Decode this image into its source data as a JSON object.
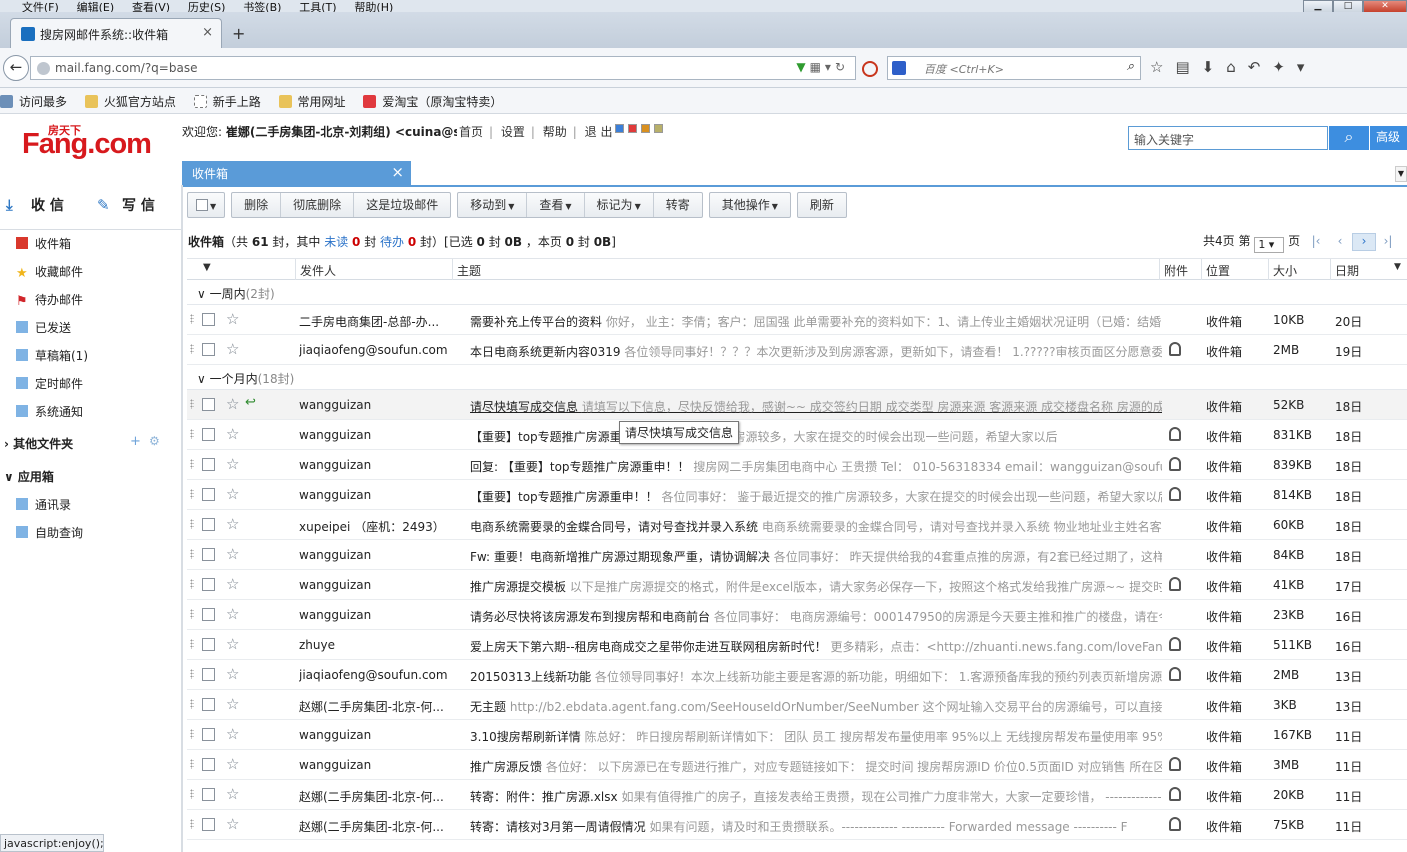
{
  "browser": {
    "menu": [
      "文件(F)",
      "编辑(E)",
      "查看(V)",
      "历史(S)",
      "书签(B)",
      "工具(T)",
      "帮助(H)"
    ],
    "tab_title": "搜房网邮件系统::收件箱",
    "url": "mail.fang.com/?q=base",
    "search_placeholder": "百度 <Ctrl+K>",
    "bookmarks": [
      "访问最多",
      "火狐官方站点",
      "新手上路",
      "常用网址",
      "爱淘宝（原淘宝特卖）"
    ],
    "status": "javascript:enjoy();"
  },
  "header": {
    "logo": "Fang.com",
    "logo_small": "房天下",
    "welcome_prefix": "欢迎您: ",
    "welcome_user": "崔娜(二手房集团-北京-刘莉组) <cuina@s",
    "links": [
      "首页",
      "设置",
      "帮助",
      "退 出"
    ],
    "search_placeholder": "输入关键字",
    "advanced": "高级",
    "skin_colors": [
      "#3b7fd8",
      "#e03a3a",
      "#d9901f",
      "#b8b06a"
    ]
  },
  "apptab": {
    "label": "收件箱"
  },
  "sidebar": {
    "receive": "收 信",
    "compose": "写 信",
    "folders": [
      {
        "label": "收件箱",
        "color": "#d9382c"
      },
      {
        "label": "收藏邮件",
        "color": "#f0b51c"
      },
      {
        "label": "待办邮件",
        "color": "#d1262b"
      },
      {
        "label": "已发送",
        "color": "#7fb3e4"
      },
      {
        "label": "草稿箱(1)",
        "color": "#7fb3e4"
      },
      {
        "label": "定时邮件",
        "color": "#7fb3e4"
      },
      {
        "label": "系统通知",
        "color": "#7fb3e4"
      }
    ],
    "other_folders": "其他文件夹",
    "apps": "应用箱",
    "app_items": [
      "通讯录",
      "自助查询"
    ]
  },
  "toolbar": {
    "groups": [
      [
        "删除",
        "彻底删除",
        "这是垃圾邮件"
      ],
      [
        "移动到",
        "查看",
        "标记为",
        "转寄"
      ],
      [
        "其他操作"
      ],
      [
        "刷新"
      ]
    ],
    "dropdowns": [
      "移动到",
      "查看",
      "标记为",
      "其他操作"
    ]
  },
  "summary": {
    "title": "收件箱",
    "total": "61",
    "unread_label": "未读",
    "unread": "0",
    "todo_label": "待办",
    "todo": "0",
    "selected": "0",
    "selected_size": "0B",
    "page_count": "0",
    "page_size": "0B"
  },
  "pager": {
    "total_pages": "共4页",
    "page_label": "第",
    "current": "1",
    "page_suffix": "页"
  },
  "columns": {
    "from": "发件人",
    "subject": "主题",
    "attach": "附件",
    "location": "位置",
    "size": "大小",
    "date": "日期"
  },
  "groups": [
    {
      "label": "一周内",
      "count": "(2封)"
    },
    {
      "label": "一个月内",
      "count": "(18封)"
    }
  ],
  "tooltip": "请尽快填写成交信息",
  "emails": [
    {
      "from": "二手房电商集团-总部-办...",
      "subject": "需要补充上传平台的资料",
      "preview": "你好， 业主：李倩；客户：屈国强 此单需要补充的资料如下：1、请上传业主婚姻状况证明（已婚：结婚",
      "att": false,
      "loc": "收件箱",
      "size": "10KB",
      "date": "20日"
    },
    {
      "from": "jiaqiaofeng@soufun.com",
      "subject": "本日电商系统更新内容0319",
      "preview": "各位领导同事好！？？？本次更新涉及到房源客源，更新如下，请查看！ 1.?????审核页面区分愿意委托",
      "att": true,
      "loc": "收件箱",
      "size": "2MB",
      "date": "19日"
    },
    {
      "from": "wangguizan",
      "subject": "请尽快填写成交信息",
      "preview": "请填写以下信息，尽快反馈给我，感谢~~ 成交签约日期 成交类型 房源来源 客源来源 成交楼盘名称 房源的成",
      "att": false,
      "loc": "收件箱",
      "size": "52KB",
      "date": "18日",
      "replied": true,
      "hover": true
    },
    {
      "from": "wangguizan",
      "subject": "【重要】top专题推广房源重",
      "preview": "鉴于最近提交的推广房源较多，大家在提交的时候会出现一些问题，希望大家以后",
      "att": true,
      "loc": "收件箱",
      "size": "831KB",
      "date": "18日"
    },
    {
      "from": "wangguizan",
      "subject": "回复: 【重要】top专题推广房源重申！！",
      "preview": "搜房网二手房集团电商中心 王贵攒 Tel： 010-56318334 email：wangguizan@soufun",
      "att": true,
      "loc": "收件箱",
      "size": "839KB",
      "date": "18日"
    },
    {
      "from": "wangguizan",
      "subject": "【重要】top专题推广房源重申！！",
      "preview": "各位同事好： 鉴于最近提交的推广房源较多，大家在提交的时候会出现一些问题，希望大家以后",
      "att": true,
      "loc": "收件箱",
      "size": "814KB",
      "date": "18日"
    },
    {
      "from": "xupeipei （座机：2493）",
      "subject": "电商系统需要录的金蝶合同号，请对号查找并录入系统",
      "preview": "电商系统需要录的金蝶合同号，请对号查找并录入系统 物业地址业主姓名客",
      "att": false,
      "loc": "收件箱",
      "size": "60KB",
      "date": "18日"
    },
    {
      "from": "wangguizan",
      "subject": "Fw: 重要！电商新增推广房源过期现象严重，请协调解决",
      "preview": "各位同事好： 昨天提供给我的4套重点推的房源，有2套已经过期了，这样",
      "att": false,
      "loc": "收件箱",
      "size": "84KB",
      "date": "18日"
    },
    {
      "from": "wangguizan",
      "subject": "推广房源提交模板",
      "preview": "以下是推广房源提交的格式，附件是excel版本，请大家务必保存一下，按照这个格式发给我推广房源~~ 提交时",
      "att": true,
      "loc": "收件箱",
      "size": "41KB",
      "date": "17日"
    },
    {
      "from": "wangguizan",
      "subject": "请务必尽快将该房源发布到搜房帮和电商前台",
      "preview": "各位同事好： 电商房源编号：000147950的房源是今天要主推和推广的楼盘，请在今",
      "att": false,
      "loc": "收件箱",
      "size": "23KB",
      "date": "16日"
    },
    {
      "from": "zhuye",
      "subject": "爱上房天下第六期--租房电商成交之星带你走进互联网租房新时代！",
      "preview": "更多精彩，点击：<http://zhuanti.news.fang.com/loveFang",
      "att": true,
      "loc": "收件箱",
      "size": "511KB",
      "date": "16日"
    },
    {
      "from": "jiaqiaofeng@soufun.com",
      "subject": "20150313上线新功能",
      "preview": "各位领导同事好！本次上线新功能主要是客源的新功能，明细如下： 1.客源预备库我的预约列表页新增房源",
      "att": true,
      "loc": "收件箱",
      "size": "2MB",
      "date": "13日"
    },
    {
      "from": "赵娜(二手房集团-北京-何...",
      "subject": "无主题",
      "preview": "http://b2.ebdata.agent.fang.com/SeeHouseIdOrNumber/SeeNumber 这个网址输入交易平台的房源编号，可以直接",
      "att": false,
      "loc": "收件箱",
      "size": "3KB",
      "date": "13日"
    },
    {
      "from": "wangguizan",
      "subject": "3.10搜房帮刷新详情",
      "preview": "陈总好： 昨日搜房帮刷新详情如下： 团队 员工 搜房帮发布量使用率 95%以上 无线搜房帮发布量使用率 95%",
      "att": false,
      "loc": "收件箱",
      "size": "167KB",
      "date": "11日"
    },
    {
      "from": "wangguizan",
      "subject": "推广房源反馈",
      "preview": "各位好： 以下房源已在专题进行推广，对应专题链接如下： 提交时间 搜房帮房源ID 价位0.5页面ID 对应销售 所在区",
      "att": true,
      "loc": "收件箱",
      "size": "3MB",
      "date": "11日"
    },
    {
      "from": "赵娜(二手房集团-北京-何...",
      "subject": "转寄：附件：推广房源.xlsx",
      "preview": "如果有值得推广的房子，直接发表给王贵攒，现在公司推广力度非常大，大家一定要珍惜， -------------",
      "att": true,
      "loc": "收件箱",
      "size": "20KB",
      "date": "11日"
    },
    {
      "from": "赵娜(二手房集团-北京-何...",
      "subject": "转寄：请核对3月第一周请假情况",
      "preview": "如果有问题，请及时和王贵攒联系。------------- ---------- Forwarded message ---------- F",
      "att": true,
      "loc": "收件箱",
      "size": "75KB",
      "date": "11日"
    }
  ]
}
